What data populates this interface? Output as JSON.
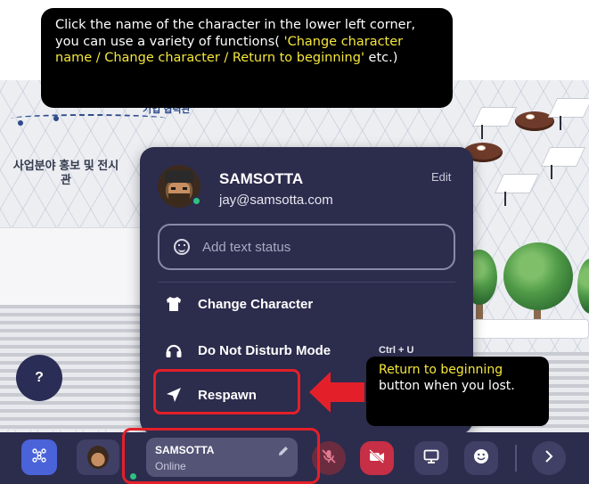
{
  "callouts": {
    "top_plain": "Click the name of the character in the lower left corner, you can use a variety of functions(",
    "top_highlight": "'Change character name / Change character / Return to beginning'",
    "top_end": " etc.)",
    "right_highlight": "Return to beginning",
    "right_plain": " button when you lost."
  },
  "scene": {
    "korean_label": "사업분야 홍보 및 전시관",
    "korean_top_label": "기업 협력관"
  },
  "help_button": {
    "label": "?"
  },
  "profile_popup": {
    "name": "SAMSOTTA",
    "email": "jay@samsotta.com",
    "edit_label": "Edit",
    "status_placeholder": "Add text status",
    "menu": [
      {
        "label": "Change Character",
        "icon": "shirt-icon"
      },
      {
        "label": "Do Not Disturb Mode",
        "icon": "headphones-icon",
        "shortcut": "Ctrl + U"
      },
      {
        "label": "Respawn",
        "icon": "navigation-arrow-icon"
      }
    ]
  },
  "toolbar": {
    "user_name": "SAMSOTTA",
    "user_status": "Online",
    "icons": [
      "grid-icon",
      "avatar",
      "pencil-icon",
      "mic-off-icon",
      "camera-off-icon",
      "screen-share-icon",
      "emoji-icon",
      "chevron-right-icon"
    ],
    "colors": {
      "bar": "#2c2c4d",
      "accent": "#4a63d9",
      "mic_off": "#6b2c40",
      "cam_off": "#c62f45",
      "online": "#2ec27e",
      "highlight": "#e3202a",
      "callout_yellow": "#f5e73a"
    }
  }
}
